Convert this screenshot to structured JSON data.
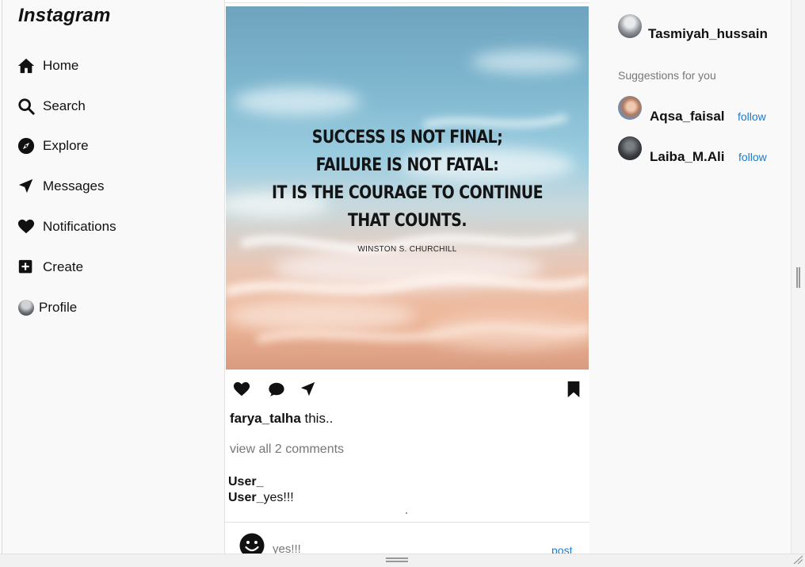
{
  "brand": "Instagram",
  "nav": [
    {
      "label": "Home",
      "icon": "home-icon"
    },
    {
      "label": "Search",
      "icon": "search-icon"
    },
    {
      "label": "Explore",
      "icon": "compass-icon"
    },
    {
      "label": "Messages",
      "icon": "send-icon"
    },
    {
      "label": "Notifications",
      "icon": "heart-icon"
    },
    {
      "label": "Create",
      "icon": "plus-square-icon"
    },
    {
      "label": "Profile",
      "icon": "avatar"
    }
  ],
  "post": {
    "quote_lines": [
      "SUCCESS IS NOT FINAL;",
      "FAILURE IS NOT FATAL:",
      "IT IS THE COURAGE TO CONTINUE",
      "THAT COUNTS."
    ],
    "quote_author": "WINSTON S. CHURCHILL",
    "username": "farya_talha",
    "caption": " this..",
    "view_all": "view all 2 comments",
    "comments": [
      {
        "user": "User_",
        "text": ""
      },
      {
        "user": "User_",
        "text": "yes!!!"
      }
    ],
    "compose_value": "yes!!!",
    "post_label": "post"
  },
  "profile": {
    "name": "Tasmiyah_hussain"
  },
  "suggestions": {
    "title": "Suggestions for you",
    "items": [
      {
        "name": "Aqsa_faisal",
        "action": "follow"
      },
      {
        "name": "Laiba_M.Ali",
        "action": "follow"
      }
    ]
  }
}
